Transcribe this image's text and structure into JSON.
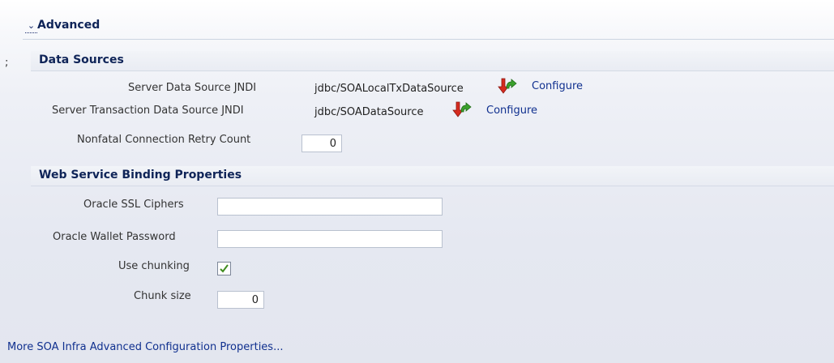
{
  "advanced": {
    "toggle_glyph": "⌄",
    "title": "Advanced"
  },
  "stray_glyph": ";",
  "data_sources": {
    "title": "Data Sources",
    "server_ds_label": "Server Data Source JNDI",
    "server_ds_value": "jdbc/SOALocalTxDataSource",
    "server_ds_link": "Configure",
    "server_tx_label": "Server Transaction Data Source JNDI",
    "server_tx_value": "jdbc/SOADataSource",
    "server_tx_link": "Configure",
    "retry_label": "Nonfatal Connection Retry Count",
    "retry_value": "0"
  },
  "ws_binding": {
    "title": "Web Service Binding Properties",
    "ssl_label": "Oracle SSL Ciphers",
    "ssl_value": "",
    "wallet_label": "Oracle Wallet Password",
    "wallet_value": "",
    "chunking_label": "Use chunking",
    "chunking_checked": true,
    "chunk_size_label": "Chunk size",
    "chunk_size_value": "0"
  },
  "more_link": "More SOA Infra Advanced Configuration Properties...",
  "icons": {
    "configure": "refresh-arrows-icon",
    "checkbox": "checkmark-icon"
  },
  "colors": {
    "link": "#10308f",
    "heading": "#0f2458",
    "icon_red": "#d62b1f",
    "icon_green": "#3aa12c",
    "check": "#3f8c1e"
  }
}
